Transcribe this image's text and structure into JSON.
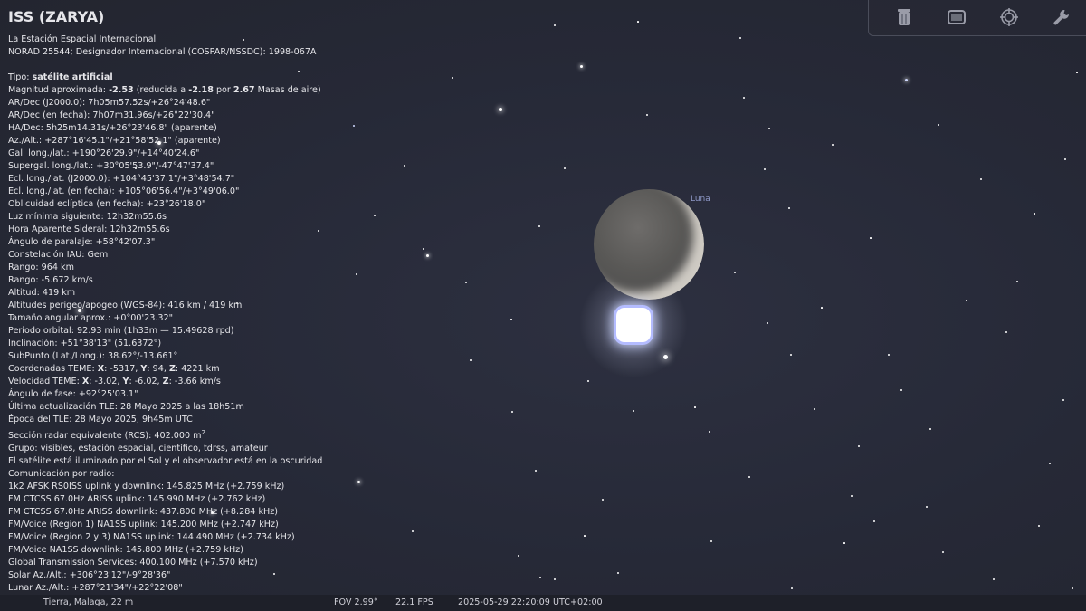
{
  "info": {
    "title": "ISS (ZARYA)",
    "lines": [
      "La Estación Espacial Internacional",
      "NORAD 25544; Designador Internacional (COSPAR/NSSDC): 1998-067A"
    ],
    "type_label": "Tipo: ",
    "type_value": "satélite artificial",
    "magnitude": {
      "label": "Magnitud aproximada: ",
      "value": "-2.53",
      "mid": " (reducida a ",
      "reduced": "-2.18",
      "por": " por ",
      "airmass": "2.67",
      "suffix": " Masas de aire)"
    },
    "rows_a": [
      "AR/Dec (J2000.0): 7h05m57.52s/+26°24'48.6\"",
      "AR/Dec (en fecha): 7h07m31.96s/+26°22'30.4\"",
      "HA/Dec: 5h25m14.31s/+26°23'46.8\" (aparente)",
      "Az./Alt.: +287°16'45.1\"/+21°58'52.1\" (aparente)",
      "Gal. long./lat.: +190°26'29.9\"/+14°40'24.6\"",
      "Supergal. long./lat.: +30°05'53.9\"/-47°47'37.4\"",
      "Ecl. long./lat. (J2000.0): +104°45'37.1\"/+3°48'54.7\"",
      "Ecl. long./lat. (en fecha): +105°06'56.4\"/+3°49'06.0\"",
      "Oblicuidad eclíptica (en fecha): +23°26'18.0\"",
      "Luz mínima siguiente: 12h32m55.6s",
      "Hora Aparente Sideral: 12h32m55.6s",
      "Ángulo de paralaje: +58°42'07.3\"",
      "Constelación IAU: Gem",
      "Rango: 964 km",
      "Rango: -5.672 km/s",
      "Altitud: 419 km",
      "Altitudes perigeo/apogeo (WGS-84): 416 km / 419 km",
      "Tamaño angular aprox.: +0°00'23.32\"",
      "Periodo orbital: 92.93 min (1h33m — 15.49628 rpd)",
      "Inclinación: +51°38'13\" (51.6372°)",
      "SubPunto (Lat./Long.): 38.62°/-13.661°"
    ],
    "teme_coords": {
      "label": "Coordenadas TEME: ",
      "x_label": "X",
      "x": ": -5317, ",
      "y_label": "Y",
      "y": ": 94, ",
      "z_label": "Z",
      "z": ": 4221 km"
    },
    "teme_velocity": {
      "label": "Velocidad TEME: ",
      "x_label": "X",
      "x": ": -3.02, ",
      "y_label": "Y",
      "y": ": -6.02, ",
      "z_label": "Z",
      "z": ": -3.66 km/s"
    },
    "rows_b": [
      "Ángulo de fase: +92°25'03.1\"",
      "Última actualización TLE: 28 Mayo 2025 a las 18h51m",
      "Época del TLE: 28 Mayo 2025, 9h45m UTC"
    ],
    "rcs": {
      "text": "Sección radar equivalente (RCS): 402.000 m",
      "sup": "2"
    },
    "rows_c": [
      "Grupo: visibles, estación espacial, científico, tdrss, amateur",
      "El satélite está iluminado por el Sol y el observador está en la oscuridad",
      "Comunicación por radio:",
      "1k2 AFSK RS0ISS uplink y downlink: 145.825 MHz (+2.759 kHz)",
      "FM CTCSS 67.0Hz ARISS uplink: 145.990 MHz (+2.762 kHz)",
      "FM CTCSS 67.0Hz ARISS downlink: 437.800 MHz (+8.284 kHz)",
      "FM/Voice (Region 1) NA1SS uplink: 145.200 MHz (+2.747 kHz)",
      "FM/Voice (Region 2 y 3) NA1SS uplink: 144.490 MHz (+2.734 kHz)",
      "FM/Voice NA1SS downlink: 145.800 MHz (+2.759 kHz)",
      "Global Transmission Services: 400.100 MHz (+7.570 kHz)",
      "Solar Az./Alt.: +306°23'12\"/-9°28'36\"",
      "Lunar Az./Alt.: +287°21'34\"/+22°22'08\""
    ]
  },
  "sky": {
    "moon_label": "Luna"
  },
  "toolbar": {
    "icons": [
      "trash-icon",
      "screen-icon",
      "target-icon",
      "wrench-icon"
    ]
  },
  "status": {
    "location": "Tierra, Malaga, 22 m",
    "fov": "FOV 2.99°",
    "fps": "22.1 FPS",
    "datetime": "2025-05-29 22:20:09 UTC+02:00"
  },
  "colors": {
    "background": "#272a36",
    "text": "#e6e6ea",
    "moon_label": "#8f99c8",
    "iss_halo": "#b4bcff"
  }
}
